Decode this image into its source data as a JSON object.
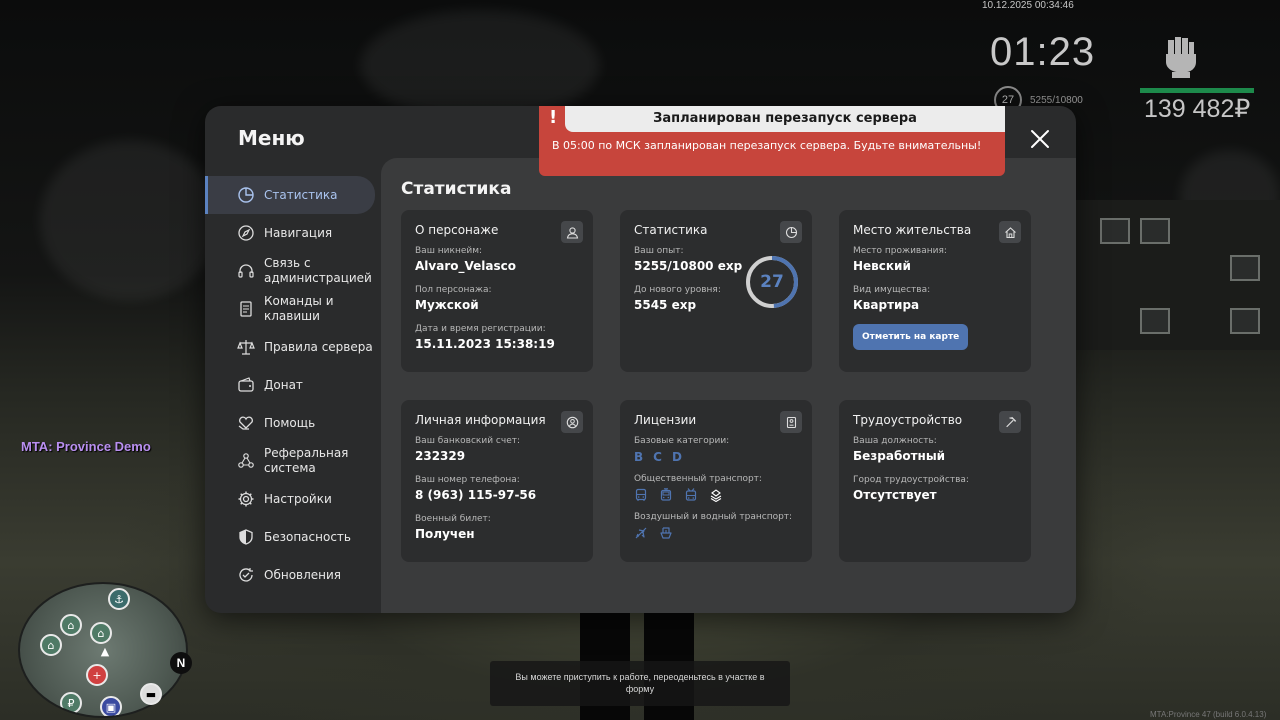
{
  "hud": {
    "datetime": "10.12.2025 00:34:46",
    "clock": "01:23",
    "level": "27",
    "exp": "5255/10800",
    "money": "139 482₽",
    "weapon_icon": "fist-icon",
    "health_color": "#1d8a4b"
  },
  "server_label": "MTA: Province Demo",
  "hint_text": "Вы можете приступить к работе, переоденьтесь в участке в форму",
  "build_text": "MTA:Province 47 (build 6.0.4.13)",
  "notification": {
    "mark": "!",
    "title": "Запланирован перезапуск сервера",
    "body": "В 05:00 по МСК запланирован перезапуск сервера. Будьте внимательны!",
    "color": "#c7453c"
  },
  "menu": {
    "title": "Меню",
    "accent_color": "#5b82c0",
    "items": [
      {
        "label": "Статистика",
        "icon": "pie-chart-icon",
        "active": true
      },
      {
        "label": "Навигация",
        "icon": "compass-icon"
      },
      {
        "label": "Связь с администрацией",
        "icon": "headset-icon"
      },
      {
        "label": "Команды и клавиши",
        "icon": "document-icon"
      },
      {
        "label": "Правила сервера",
        "icon": "scales-icon"
      },
      {
        "label": "Донат",
        "icon": "wallet-icon"
      },
      {
        "label": "Помощь",
        "icon": "heart-hand-icon"
      },
      {
        "label": "Реферальная система",
        "icon": "network-icon"
      },
      {
        "label": "Настройки",
        "icon": "gear-icon"
      },
      {
        "label": "Безопасность",
        "icon": "shield-icon"
      },
      {
        "label": "Обновления",
        "icon": "refresh-check-icon"
      }
    ]
  },
  "stats": {
    "section_title": "Статистика",
    "character": {
      "title": "О персонаже",
      "icon": "user-icon",
      "nickname_label": "Ваш никнейм:",
      "nickname": "Alvaro_Velasco",
      "gender_label": "Пол персонажа:",
      "gender": "Мужской",
      "reg_label": "Дата и время регистрации:",
      "reg_value": "15.11.2023 15:38:19"
    },
    "statistics": {
      "title": "Статистика",
      "icon": "pie-chart-icon",
      "exp_label": "Ваш опыт:",
      "exp_value": "5255/10800 exp",
      "next_label": "До нового уровня:",
      "next_value": "5545 exp",
      "level": "27",
      "progress": 0.4866
    },
    "residence": {
      "title": "Место жительства",
      "icon": "house-icon",
      "place_label": "Место проживания:",
      "place": "Невский",
      "property_label": "Вид имущества:",
      "property": "Квартира",
      "button": "Отметить на карте"
    },
    "personal": {
      "title": "Личная информация",
      "icon": "user-circle-icon",
      "bank_label": "Ваш банковский счет:",
      "bank": "232329",
      "phone_label": "Ваш номер телефона:",
      "phone": "8 (963) 115-97-56",
      "military_label": "Военный билет:",
      "military": "Получен"
    },
    "licenses": {
      "title": "Лицензии",
      "icon": "id-card-icon",
      "base_label": "Базовые категории:",
      "categories": [
        "B",
        "C",
        "D"
      ],
      "public_label": "Общественный транспорт:",
      "public_icons": [
        "bus-icon",
        "tram-icon",
        "trolleybus-icon",
        "taxi-icon"
      ],
      "air_label": "Воздушный и водный транспорт:",
      "air_icons": [
        "plane-icon",
        "boat-icon"
      ]
    },
    "employment": {
      "title": "Трудоустройство",
      "icon": "pickaxe-icon",
      "position_label": "Ваша должность:",
      "position": "Безработный",
      "city_label": "Город трудоустройства:",
      "city": "Отсутствует"
    }
  }
}
